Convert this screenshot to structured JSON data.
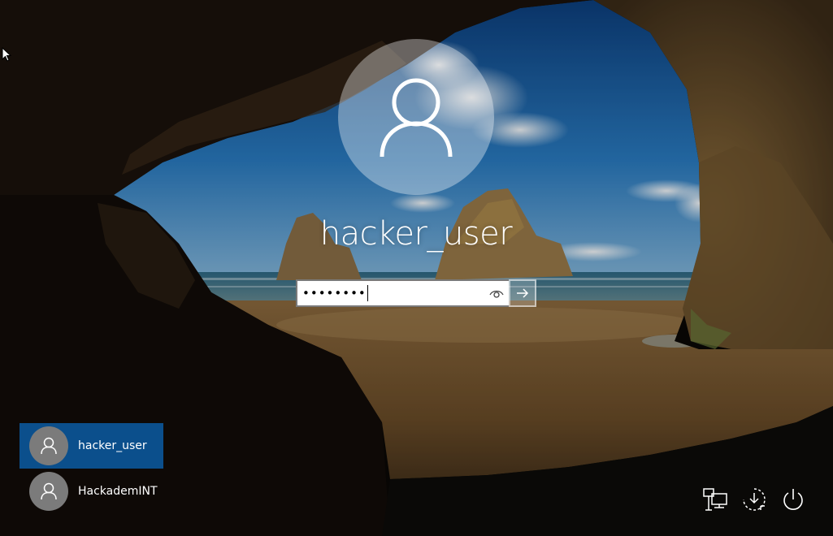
{
  "login": {
    "username": "hacker_user",
    "password_masked": "••••••••",
    "password_length": 8
  },
  "user_list": [
    {
      "name": "hacker_user",
      "selected": true
    },
    {
      "name": "HackademINT",
      "selected": false
    }
  ],
  "tray": {
    "icons": [
      "network-icon",
      "ease-of-access-icon",
      "power-icon"
    ]
  },
  "colors": {
    "selected_user_bg": "#0b4f8c",
    "avatar_circle": "rgba(255,255,255,0.36)",
    "small_avatar_bg": "#7b7b7b",
    "text": "#ffffff"
  }
}
